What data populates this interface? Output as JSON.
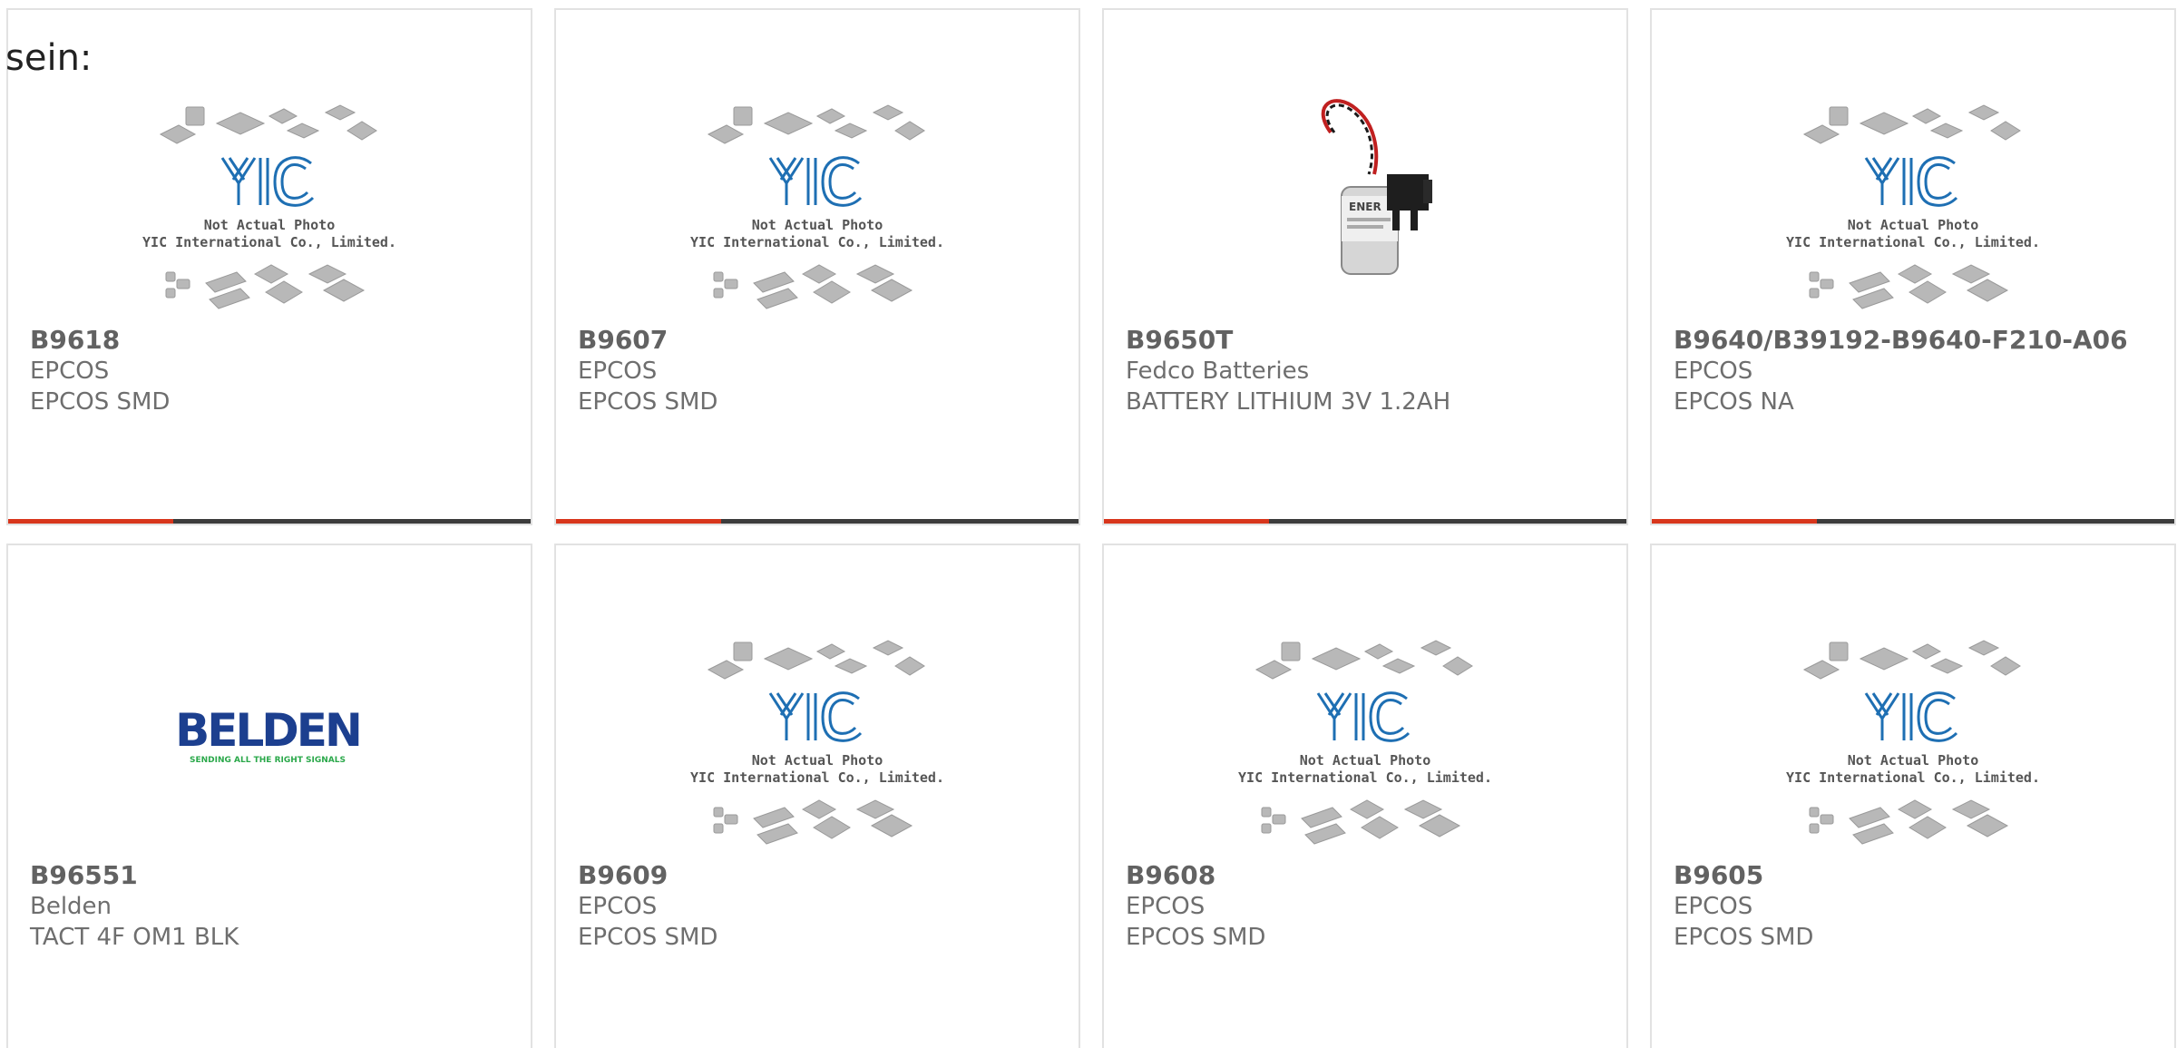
{
  "heading": "sein:",
  "placeholder_image": {
    "brand": "YIC",
    "line1": "Not Actual Photo",
    "line2": "YIC International Co., Limited."
  },
  "belden_logo": {
    "name": "BELDEN",
    "tagline": "SENDING ALL THE RIGHT SIGNALS"
  },
  "colors": {
    "accent": "#d8361c",
    "bar": "#3c3c3c",
    "yic_blue": "#1e6fb3",
    "belden_blue": "#1c3f8f",
    "belden_green": "#2aa84a"
  },
  "products": [
    {
      "part_number": "B9618",
      "manufacturer": "EPCOS",
      "description": "EPCOS SMD",
      "image": "yic-placeholder"
    },
    {
      "part_number": "B9607",
      "manufacturer": "EPCOS",
      "description": "EPCOS SMD",
      "image": "yic-placeholder"
    },
    {
      "part_number": "B9650T",
      "manufacturer": "Fedco Batteries",
      "description": "BATTERY LITHIUM 3V 1.2AH",
      "image": "battery-photo"
    },
    {
      "part_number": "B9640/B39192-B9640-F210-A06",
      "manufacturer": "EPCOS",
      "description": "EPCOS NA",
      "image": "yic-placeholder"
    },
    {
      "part_number": "B96551",
      "manufacturer": "Belden",
      "description": "TACT 4F OM1 BLK",
      "image": "belden-logo"
    },
    {
      "part_number": "B9609",
      "manufacturer": "EPCOS",
      "description": "EPCOS SMD",
      "image": "yic-placeholder"
    },
    {
      "part_number": "B9608",
      "manufacturer": "EPCOS",
      "description": "EPCOS SMD",
      "image": "yic-placeholder"
    },
    {
      "part_number": "B9605",
      "manufacturer": "EPCOS",
      "description": "EPCOS SMD",
      "image": "yic-placeholder"
    }
  ]
}
